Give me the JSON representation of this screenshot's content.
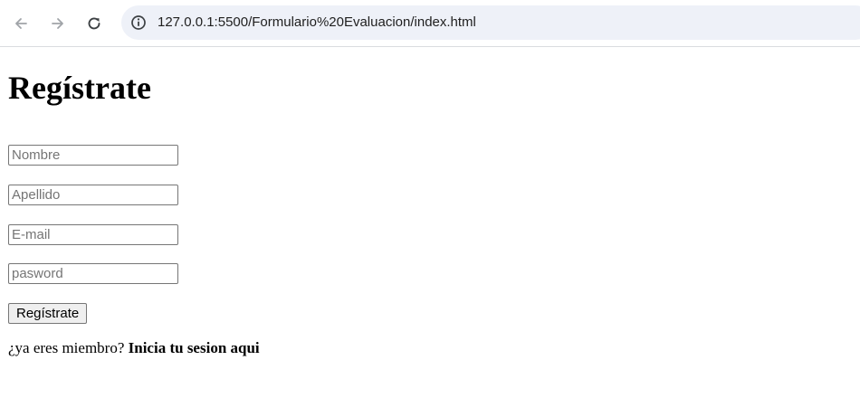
{
  "browser": {
    "url": "127.0.0.1:5500/Formulario%20Evaluacion/index.html",
    "back_icon": "arrow-left-icon",
    "forward_icon": "arrow-right-icon",
    "reload_icon": "reload-icon",
    "info_icon": "info-icon"
  },
  "form": {
    "title": "Regístrate",
    "fields": {
      "nombre_placeholder": "Nombre",
      "apellido_placeholder": "Apellido",
      "email_placeholder": "E-mail",
      "password_placeholder": "pasword"
    },
    "submit_label": "Regístrate",
    "member_prompt": "¿ya eres miembro?",
    "login_link": "Inicia tu sesion aqui"
  }
}
